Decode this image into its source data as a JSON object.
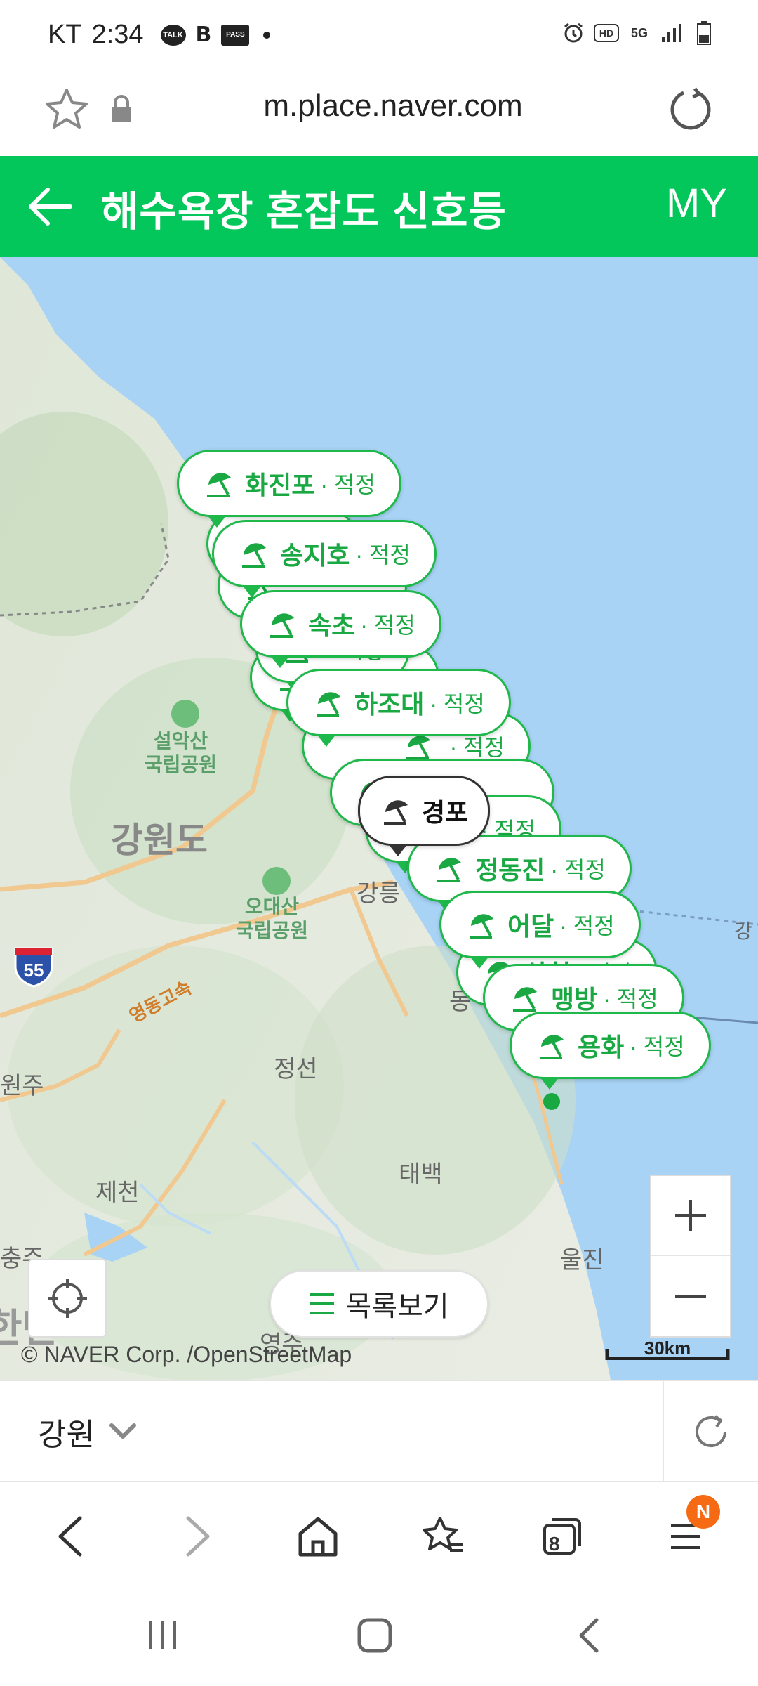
{
  "status_bar": {
    "carrier": "KT",
    "time": "2:34",
    "talk_icon": "TALK",
    "b_icon": "B",
    "pass_icon": "PASS",
    "hd_icon": "HD",
    "network_icon": "5G"
  },
  "url_bar": {
    "url": "m.place.naver.com"
  },
  "header": {
    "title": "해수욕장 혼잡도 신호등",
    "my_label": "MY"
  },
  "map": {
    "labels": {
      "gangwon": "강원도",
      "seorak": "설악산\n국립공원",
      "odaesan": "오대산\n국립공원",
      "gangneung": "강릉",
      "jeongseon": "정선",
      "taebaek": "태백",
      "jecheon": "제천",
      "wonju": "원주",
      "chungju": "충주",
      "uljin": "울진",
      "yeongju": "영주",
      "dong": "동",
      "gang_right": "강",
      "hwy_number": "55",
      "hwy_name": "영동고속",
      "hanbando": "한반"
    },
    "pins": [
      {
        "name": "화진포",
        "status": "적정"
      },
      {
        "name": "",
        "status": "적정"
      },
      {
        "name": "송지호",
        "status": "적정"
      },
      {
        "name": "",
        "status": ""
      },
      {
        "name": "",
        "status": ""
      },
      {
        "name": "속초",
        "status": "적정"
      },
      {
        "name": "",
        "status": "적정"
      },
      {
        "name": "하조대",
        "status": "적정"
      },
      {
        "name": "",
        "status": "적정"
      },
      {
        "name": "",
        "status": ""
      },
      {
        "name": "",
        "status": "적정"
      },
      {
        "name": "정동진",
        "status": "적정"
      },
      {
        "name": "어달",
        "status": "적정"
      },
      {
        "name": "삼척",
        "status": "적정"
      },
      {
        "name": "맹방",
        "status": "적정"
      },
      {
        "name": "용화",
        "status": "적정"
      }
    ],
    "selected_pin": {
      "name": "경포"
    },
    "list_button_label": "목록보기",
    "copyright": "© NAVER Corp. /OpenStreetMap",
    "scale_label": "30km"
  },
  "region_bar": {
    "region": "강원"
  },
  "browser_nav": {
    "tabs_count": "8",
    "menu_badge": "N"
  }
}
